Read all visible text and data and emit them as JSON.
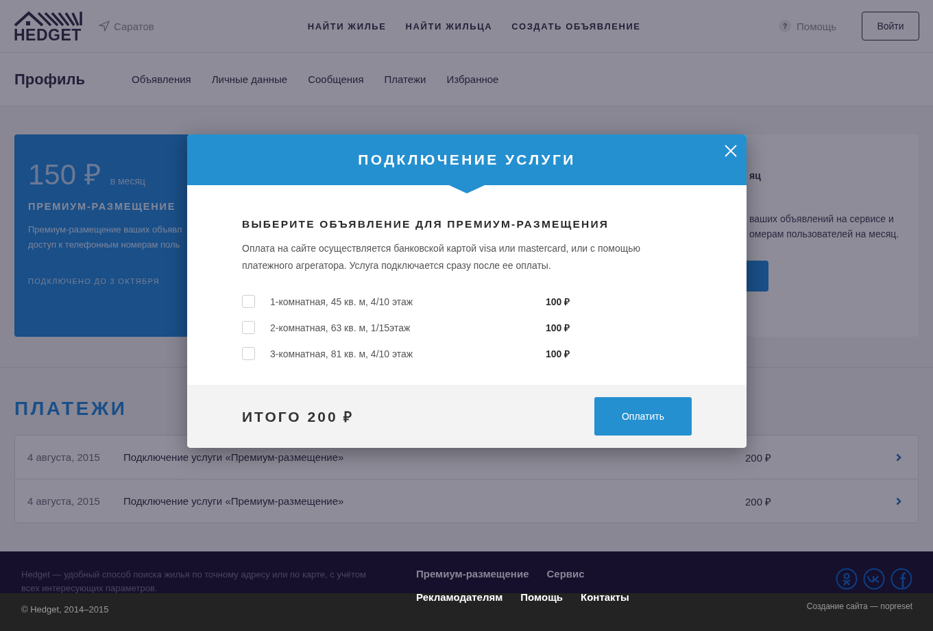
{
  "header": {
    "logo": "HEDGET",
    "city": "Саратов",
    "nav": [
      "НАЙТИ ЖИЛЬЕ",
      "НАЙТИ ЖИЛЬЦА",
      "СОЗДАТЬ ОБЪЯВЛЕНИЕ"
    ],
    "help_badge": "?",
    "help": "Помощь",
    "login": "Войти"
  },
  "profile_nav": {
    "title": "Профиль",
    "items": [
      "Объявления",
      "Личные данные",
      "Сообщения",
      "Платежи",
      "Избранное"
    ]
  },
  "service_cards": [
    {
      "kind": "active",
      "price": "150 ₽",
      "period": "в месяц",
      "title": "ПРЕМИУМ-РАЗМЕЩЕНИЕ",
      "description_lines": [
        "Премиум-размещение ваших объявл",
        "доступ к телефонным номерам поль"
      ],
      "status": "ПОДКЛЮЧЕНО ДО 3 ОКТЯБРЯ"
    },
    {
      "kind": "inactive",
      "period": "яц",
      "description_lines": [
        "ваших объявлений на сервисе и",
        "омерам пользователей на месяц."
      ]
    }
  ],
  "payments": {
    "title": "ПЛАТЕЖИ",
    "rows": [
      {
        "date": "4 августа, 2015",
        "description": "Подключение услуги «Премиум-размещение»",
        "amount": "200 ₽"
      },
      {
        "date": "4 августа, 2015",
        "description": "Подключение услуги «Премиум-размещение»",
        "amount": "200 ₽"
      }
    ]
  },
  "footer": {
    "about": "Hedget — удобный способ поиска жилья по точному адресу или по карте, с учётом всех интересующих параметров.",
    "links_top": [
      "Премиум-размещение",
      "Сервис"
    ],
    "links_bottom": [
      "Рекламодателям",
      "Помощь",
      "Контакты"
    ],
    "copyright": "© Hedget, 2014–2015",
    "credit": "Создание сайта — nopreset"
  },
  "modal": {
    "title": "ПОДКЛЮЧЕНИЕ УСЛУГИ",
    "subtitle": "ВЫБЕРИТЕ ОБЪЯВЛЕНИЕ ДЛЯ ПРЕМИУМ-РАЗМЕЩЕНИЯ",
    "text": "Оплата на сайте осуществляется банковской картой visa или mastercard, или с помощью платежного агрегатора. Услуга подключается сразу после ее оплаты.",
    "listings": [
      {
        "label": "1-комнатная, 45 кв. м, 4/10 этаж",
        "price": "100 ₽",
        "checked": false
      },
      {
        "label": "2-комнатная, 63 кв. м, 1/15этаж",
        "price": "100 ₽",
        "checked": false
      },
      {
        "label": "3-комнатная, 81 кв. м, 4/10 этаж",
        "price": "100 ₽",
        "checked": false
      }
    ],
    "total": "ИТОГО 200 ₽",
    "pay_button": "Оплатить"
  }
}
